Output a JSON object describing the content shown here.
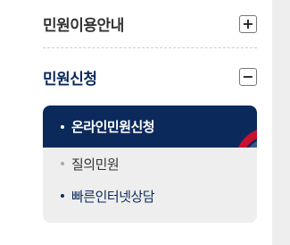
{
  "menu": {
    "sections": [
      {
        "label": "민원이용안내",
        "expanded": false,
        "toggle_symbol": "+"
      },
      {
        "label": "민원신청",
        "expanded": true,
        "toggle_symbol": "−"
      }
    ],
    "submenu": [
      {
        "label": "온라인민원신청",
        "selected": true
      },
      {
        "label": "질의민원",
        "selected": false
      },
      {
        "label": "빠른인터넷상담",
        "selected": false
      }
    ]
  },
  "colors": {
    "active_navy": "#0b2a5b",
    "submenu_bg": "#eeeeee",
    "accent_red": "#c8102e"
  },
  "icons": {
    "collapsed_toggle": "plus-icon",
    "expanded_toggle": "minus-icon",
    "selected_decoration": "swoosh-decoration"
  }
}
